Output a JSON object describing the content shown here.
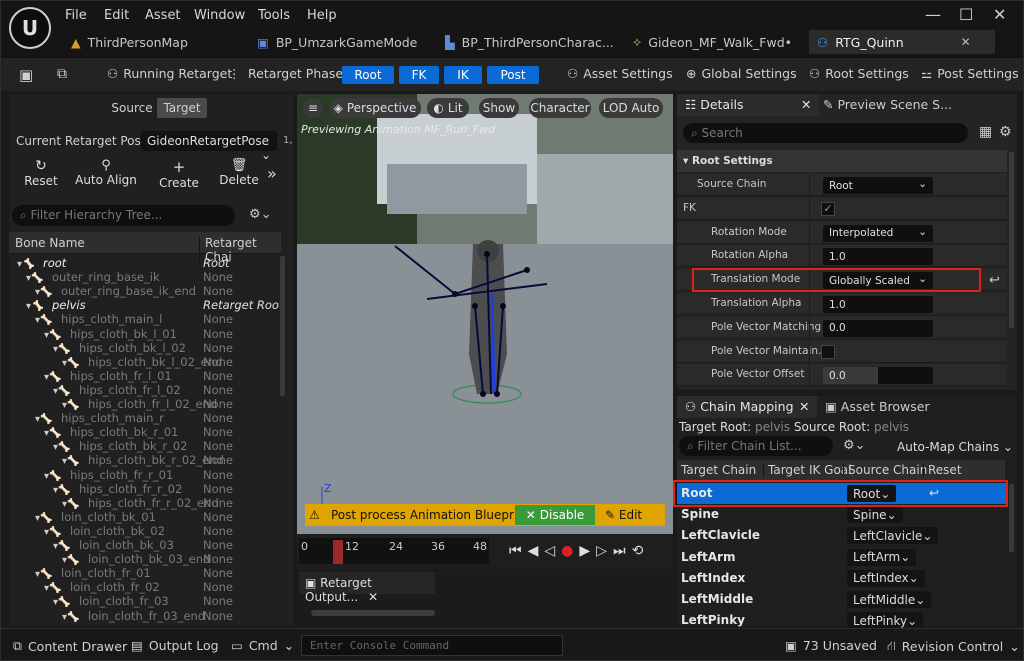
{
  "app": {
    "logo": "U"
  },
  "menu": [
    "File",
    "Edit",
    "Asset",
    "Window",
    "Tools",
    "Help"
  ],
  "tabs": [
    "ThirdPersonMap",
    "BP_UmzarkGameMode",
    "BP_ThirdPersonCharac...",
    "Gideon_MF_Walk_Fwd•",
    "RTG_Quinn"
  ],
  "toolbar": {
    "running": "Running Retarget",
    "phases_label": "Retarget Phases:",
    "phases": [
      "Root",
      "FK",
      "IK",
      "Post"
    ],
    "asset_settings": "Asset Settings",
    "global_settings": "Global Settings",
    "root_settings": "Root Settings",
    "post_settings": "Post Settings"
  },
  "left": {
    "source": "Source",
    "target": "Target",
    "pose_label": "Current Retarget Pose:",
    "pose_value": "GideonRetargetPose",
    "pose_extra": "1,",
    "actions": [
      "Reset",
      "Auto Align",
      "Create",
      "Delete"
    ],
    "filter_placeholder": "Filter Hierarchy Tree...",
    "col_bone": "Bone Name",
    "col_chain": "Retarget Chai",
    "bones": [
      {
        "name": "root",
        "chain": "Root",
        "indent": 0,
        "active": true
      },
      {
        "name": "outer_ring_base_ik",
        "chain": "None",
        "indent": 1,
        "active": false
      },
      {
        "name": "outer_ring_base_ik_end",
        "chain": "None",
        "indent": 2,
        "active": false
      },
      {
        "name": "pelvis",
        "chain": "Retarget Root",
        "indent": 1,
        "active": true
      },
      {
        "name": "hips_cloth_main_l",
        "chain": "None",
        "indent": 2,
        "active": false
      },
      {
        "name": "hips_cloth_bk_l_01",
        "chain": "None",
        "indent": 3,
        "active": false
      },
      {
        "name": "hips_cloth_bk_l_02",
        "chain": "None",
        "indent": 4,
        "active": false
      },
      {
        "name": "hips_cloth_bk_l_02_end",
        "chain": "None",
        "indent": 5,
        "active": false
      },
      {
        "name": "hips_cloth_fr_l_01",
        "chain": "None",
        "indent": 3,
        "active": false
      },
      {
        "name": "hips_cloth_fr_l_02",
        "chain": "None",
        "indent": 4,
        "active": false
      },
      {
        "name": "hips_cloth_fr_l_02_end",
        "chain": "None",
        "indent": 5,
        "active": false
      },
      {
        "name": "hips_cloth_main_r",
        "chain": "None",
        "indent": 2,
        "active": false
      },
      {
        "name": "hips_cloth_bk_r_01",
        "chain": "None",
        "indent": 3,
        "active": false
      },
      {
        "name": "hips_cloth_bk_r_02",
        "chain": "None",
        "indent": 4,
        "active": false
      },
      {
        "name": "hips_cloth_bk_r_02_end",
        "chain": "None",
        "indent": 5,
        "active": false
      },
      {
        "name": "hips_cloth_fr_r_01",
        "chain": "None",
        "indent": 3,
        "active": false
      },
      {
        "name": "hips_cloth_fr_r_02",
        "chain": "None",
        "indent": 4,
        "active": false
      },
      {
        "name": "hips_cloth_fr_r_02_end",
        "chain": "None",
        "indent": 5,
        "active": false
      },
      {
        "name": "loin_cloth_bk_01",
        "chain": "None",
        "indent": 2,
        "active": false
      },
      {
        "name": "loin_cloth_bk_02",
        "chain": "None",
        "indent": 3,
        "active": false
      },
      {
        "name": "loin_cloth_bk_03",
        "chain": "None",
        "indent": 4,
        "active": false
      },
      {
        "name": "loin_cloth_bk_03_end",
        "chain": "None",
        "indent": 5,
        "active": false
      },
      {
        "name": "loin_cloth_fr_01",
        "chain": "None",
        "indent": 2,
        "active": false
      },
      {
        "name": "loin_cloth_fr_02",
        "chain": "None",
        "indent": 3,
        "active": false
      },
      {
        "name": "loin_cloth_fr_03",
        "chain": "None",
        "indent": 4,
        "active": false
      },
      {
        "name": "loin_cloth_fr_03_end",
        "chain": "None",
        "indent": 5,
        "active": false
      }
    ]
  },
  "viewport": {
    "perspective": "Perspective",
    "lit": "Lit",
    "show": "Show",
    "character": "Character",
    "lod": "LOD Auto",
    "preview": "Previewing Animation MF_Run_Fwd",
    "axis_z": "Z",
    "warning": "Post process Animation Blueprin",
    "disable": "Disable",
    "edit": "Edit"
  },
  "timeline": {
    "ticks": [
      "0",
      "12",
      "24",
      "36",
      "48"
    ]
  },
  "output_tab": "Retarget Output...",
  "details": {
    "tab": "Details",
    "tab2": "Preview Scene S...",
    "search_placeholder": "Search",
    "section": "Root Settings",
    "rows": [
      {
        "label": "Source Chain",
        "value": "Root",
        "kind": "dropdown"
      },
      {
        "label": "FK",
        "value": "",
        "kind": "check"
      },
      {
        "label": "Rotation Mode",
        "value": "Interpolated",
        "kind": "dropdown"
      },
      {
        "label": "Rotation Alpha",
        "value": "1.0",
        "kind": "number"
      },
      {
        "label": "Translation Mode",
        "value": "Globally Scaled",
        "kind": "dropdown"
      },
      {
        "label": "Translation Alpha",
        "value": "1.0",
        "kind": "number"
      },
      {
        "label": "Pole Vector Matching",
        "value": "0.0",
        "kind": "number"
      },
      {
        "label": "Pole Vector Maintain...",
        "value": "",
        "kind": "uncheck"
      },
      {
        "label": "Pole Vector Offset",
        "value": "0.0",
        "kind": "slider"
      }
    ]
  },
  "chain": {
    "tab": "Chain Mapping",
    "tab2": "Asset Browser",
    "target_root_label": "Target Root:",
    "target_root": "pelvis",
    "source_root_label": "Source Root:",
    "source_root": "pelvis",
    "filter_placeholder": "Filter Chain List...",
    "automap": "Auto-Map Chains",
    "cols": [
      "Target Chain",
      "Target IK Goal",
      "Source Chain",
      "Reset"
    ],
    "rows": [
      {
        "target": "Root",
        "source": "Root"
      },
      {
        "target": "Spine",
        "source": "Spine"
      },
      {
        "target": "LeftClavicle",
        "source": "LeftClavicle"
      },
      {
        "target": "LeftArm",
        "source": "LeftArm"
      },
      {
        "target": "LeftIndex",
        "source": "LeftIndex"
      },
      {
        "target": "LeftMiddle",
        "source": "LeftMiddle"
      },
      {
        "target": "LeftPinky",
        "source": "LeftPinky"
      }
    ]
  },
  "status": {
    "content_drawer": "Content Drawer",
    "output_log": "Output Log",
    "cmd": "Cmd",
    "console_placeholder": "Enter Console Command",
    "unsaved": "73 Unsaved",
    "revision": "Revision Control"
  }
}
